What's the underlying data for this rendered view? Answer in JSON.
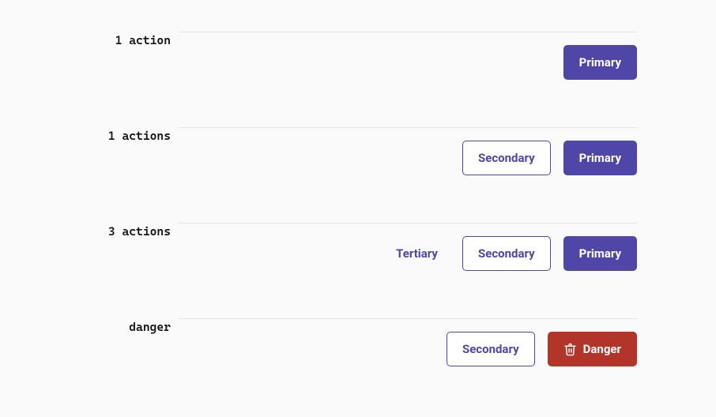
{
  "rows": [
    {
      "label": "1 action",
      "buttons": [
        {
          "variant": "primary",
          "text": "Primary",
          "name": "primary-button",
          "icon": null
        }
      ]
    },
    {
      "label": "1 actions",
      "buttons": [
        {
          "variant": "secondary",
          "text": "Secondary",
          "name": "secondary-button",
          "icon": null
        },
        {
          "variant": "primary",
          "text": "Primary",
          "name": "primary-button",
          "icon": null
        }
      ]
    },
    {
      "label": "3 actions",
      "buttons": [
        {
          "variant": "tertiary",
          "text": "Tertiary",
          "name": "tertiary-button",
          "icon": null
        },
        {
          "variant": "secondary",
          "text": "Secondary",
          "name": "secondary-button",
          "icon": null
        },
        {
          "variant": "primary",
          "text": "Primary",
          "name": "primary-button",
          "icon": null
        }
      ]
    },
    {
      "label": "danger",
      "buttons": [
        {
          "variant": "secondary",
          "text": "Secondary",
          "name": "secondary-button",
          "icon": null
        },
        {
          "variant": "danger",
          "text": "Danger",
          "name": "danger-button",
          "icon": "trash"
        }
      ]
    }
  ]
}
